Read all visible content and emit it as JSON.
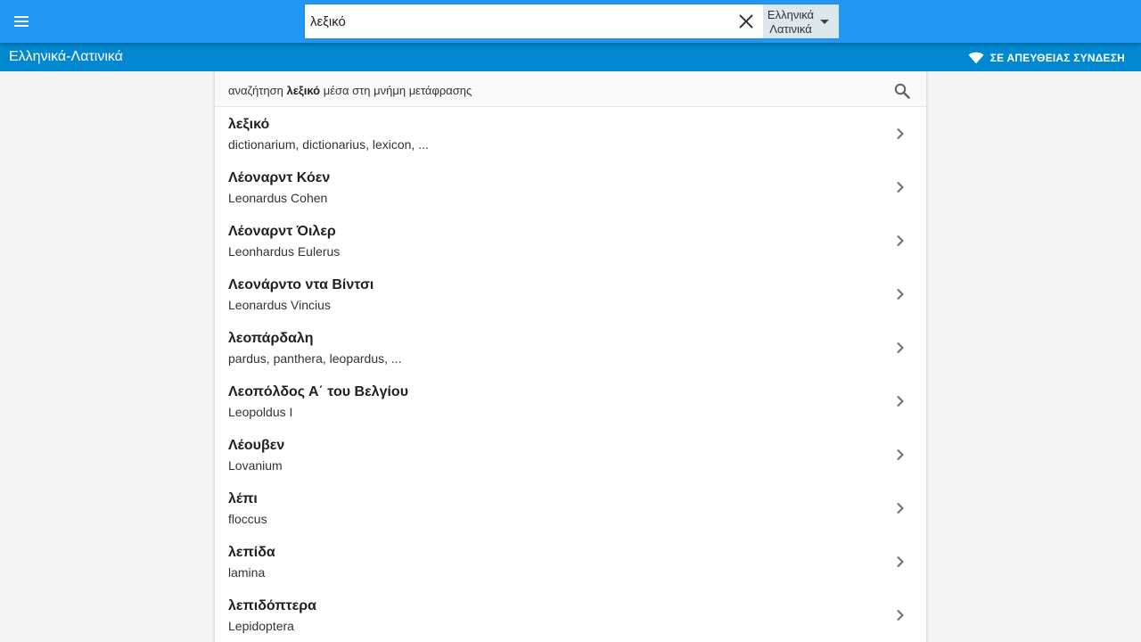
{
  "header": {
    "menu_icon": "menu-icon",
    "search": {
      "value": "λεξικό",
      "placeholder": ""
    },
    "clear_icon": "close-icon",
    "language": {
      "line1": "Ελληνικά",
      "line2": "Λατινικά",
      "dropdown_icon": "caret-down-icon"
    }
  },
  "subheader": {
    "title": "Ελληνικά-Λατινικά",
    "status_icon": "wifi-icon",
    "status": "ΣΕ ΑΠΕΥΘΕΙΑΣ ΣΥΝΔΕΣΗ"
  },
  "tm_search": {
    "prefix": "αναζήτηση",
    "term": "λεξικό",
    "suffix": "μέσα στη μνήμη μετάφρασης",
    "icon": "search-icon"
  },
  "results": [
    {
      "term": "λεξικό",
      "translation": "dictionarium, dictionarius, lexicon, ..."
    },
    {
      "term": "Λέοναρντ Κόεν",
      "translation": "Leonardus Cohen"
    },
    {
      "term": "Λέοναρντ Όιλερ",
      "translation": "Leonhardus Eulerus"
    },
    {
      "term": "Λεονάρντο ντα Βίντσι",
      "translation": "Leonardus Vincius"
    },
    {
      "term": "λεοπάρδαλη",
      "translation": "pardus, panthera, leopardus, ..."
    },
    {
      "term": "Λεοπόλδος Α΄ του Βελγίου",
      "translation": "Leopoldus I"
    },
    {
      "term": "Λέουβεν",
      "translation": "Lovanium"
    },
    {
      "term": "λέπι",
      "translation": "floccus"
    },
    {
      "term": "λεπίδα",
      "translation": "lamina"
    },
    {
      "term": "λεπιδόπτερα",
      "translation": "Lepidoptera"
    }
  ],
  "colors": {
    "topbar": "#2196f3",
    "subbar": "#0288d1",
    "language_select_bg": "#dde7ee",
    "page_bg": "#f5f5f5"
  }
}
